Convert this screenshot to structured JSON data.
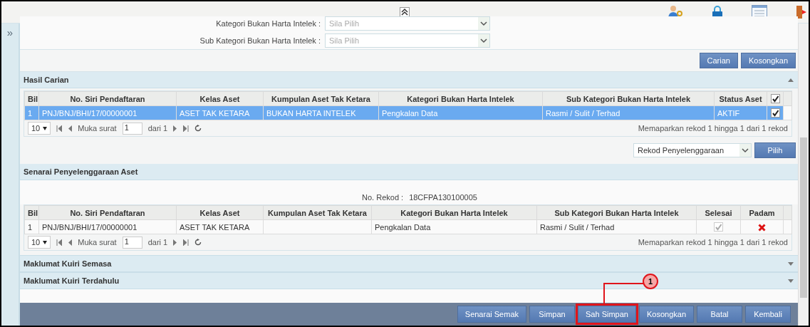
{
  "sidebar_toggle": "»",
  "filters": [
    {
      "label": "Kategori Bukan Harta Intelek :",
      "placeholder": "Sila Pilih"
    },
    {
      "label": "Sub Kategori Bukan Harta Intelek :",
      "placeholder": "Sila Pilih"
    }
  ],
  "search_buttons": [
    "Carian",
    "Kosongkan"
  ],
  "results": {
    "title": "Hasil Carian",
    "expanded": true,
    "header_checked": true,
    "columns": [
      "Bil",
      "No. Siri Pendaftaran",
      "Kelas Aset",
      "Kumpulan Aset Tak Ketara",
      "Kategori Bukan Harta Intelek",
      "Sub Kategori Bukan Harta Intelek",
      "Status Aset"
    ],
    "rows": [
      {
        "cells": [
          "1",
          "PNJ/BNJ/BHI/17/00000001",
          "ASET TAK KETARA",
          "BUKAN HARTA INTELEK",
          "Pengkalan Data",
          "Rasmi / Sulit / Terhad",
          "AKTIF"
        ],
        "selected": true,
        "checked": true
      }
    ],
    "pager": {
      "page_size": "10",
      "page_label": "Muka surat",
      "page": "1",
      "of": "dari 1",
      "summary": "Memaparkan rekod 1 hingga 1 dari 1 rekod"
    }
  },
  "record_select": {
    "value": "Rekod Penyelenggaraan",
    "button": "Pilih"
  },
  "maintenance": {
    "title": "Senarai Penyelenggaraan Aset",
    "record_label": "No. Rekod :",
    "record_no": "18CFPA130100005",
    "columns": [
      "Bil",
      "No. Siri Pendaftaran",
      "Kelas Aset",
      "Kumpulan Aset Tak Ketara",
      "Kategori Bukan Harta Intelek",
      "Sub Kategori Bukan Harta Intelek",
      "Selesai",
      "Padam"
    ],
    "rows": [
      {
        "cells": [
          "1",
          "PNJ/BNJ/BHI/17/00000001",
          "ASET TAK KETARA",
          null,
          "Pengkalan Data",
          "Rasmi / Sulit / Terhad"
        ],
        "done": true,
        "deletable": true
      }
    ],
    "pager": {
      "page_size": "10",
      "page_label": "Muka surat",
      "page": "1",
      "of": "dari 1",
      "summary": "Memaparkan rekod 1 hingga 1 dari 1 rekod"
    }
  },
  "collapsed_panels": [
    {
      "title": "Maklumat Kuiri Semasa",
      "expanded": false
    },
    {
      "title": "Maklumat Kuiri Terdahulu",
      "expanded": false
    }
  ],
  "footer_buttons": [
    {
      "label": "Senarai Semak",
      "highlighted": false
    },
    {
      "label": "Simpan",
      "highlighted": false
    },
    {
      "label": "Sah Simpan",
      "highlighted": true,
      "callout": "1"
    },
    {
      "label": "Kosongkan",
      "highlighted": false
    },
    {
      "label": "Batal",
      "highlighted": false
    },
    {
      "label": "Kembali",
      "highlighted": false
    }
  ]
}
